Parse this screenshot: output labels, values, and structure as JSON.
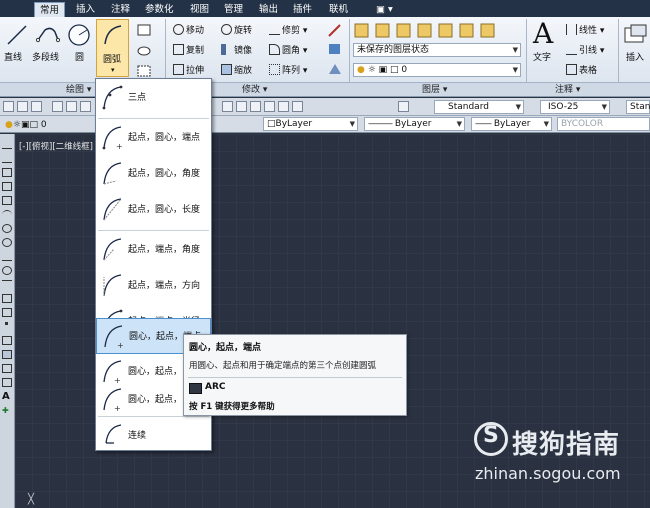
{
  "tabs": [
    "常用",
    "插入",
    "注释",
    "参数化",
    "视图",
    "管理",
    "输出",
    "插件",
    "联机"
  ],
  "tab_extra": "▣ ▾",
  "draw_tools": {
    "line": "直线",
    "polyline": "多段线",
    "circle": "圆",
    "arc": "圆弧"
  },
  "modify_tools": {
    "move": "移动",
    "rotate": "旋转",
    "trim": "修剪",
    "copy": "复制",
    "mirror": "镜像",
    "fillet": "圆角",
    "stretch": "拉伸",
    "scale": "缩放",
    "array": "阵列"
  },
  "layer": {
    "state_combo": "未保存的图层状态",
    "current_layer": "0"
  },
  "annotation": {
    "text": "文字",
    "linear": "线性",
    "leader": "引线",
    "table": "表格"
  },
  "insert": {
    "label": "插入"
  },
  "panels": {
    "draw": "绘图",
    "modify": "修改",
    "layers": "图层",
    "annotation": "注释"
  },
  "toolbar2": {
    "text_style": "Standard",
    "dim_style": "ISO-25",
    "table_style": "Stan"
  },
  "toolbar3": {
    "layer_value": "0",
    "color": "ByLayer",
    "linetype": "ByLayer",
    "lineweight": "ByLayer",
    "plotstyle": "BYCOLOR"
  },
  "viewport_label": "[-][俯视][二维线框]",
  "arc_menu": [
    "三点",
    "起点，圆心，端点",
    "起点，圆心，角度",
    "起点，圆心，长度",
    "起点，端点，角度",
    "起点，端点，方向",
    "起点，端点，半径",
    "圆心，起点，端点",
    "圆心，起点，",
    "圆心，起点，",
    "连续"
  ],
  "tooltip": {
    "title": "圆心，起点，端点",
    "desc": "用圆心、起点和用于确定端点的第三个点创建圆弧",
    "command": "ARC",
    "help": "按 F1 键获得更多帮助"
  },
  "watermark": {
    "text": "搜狗指南",
    "url": "zhinan.sogou.com"
  },
  "colors": {
    "canvas": "#2a3140",
    "tabbar": "#233246",
    "highlight": "#cde3f7"
  }
}
